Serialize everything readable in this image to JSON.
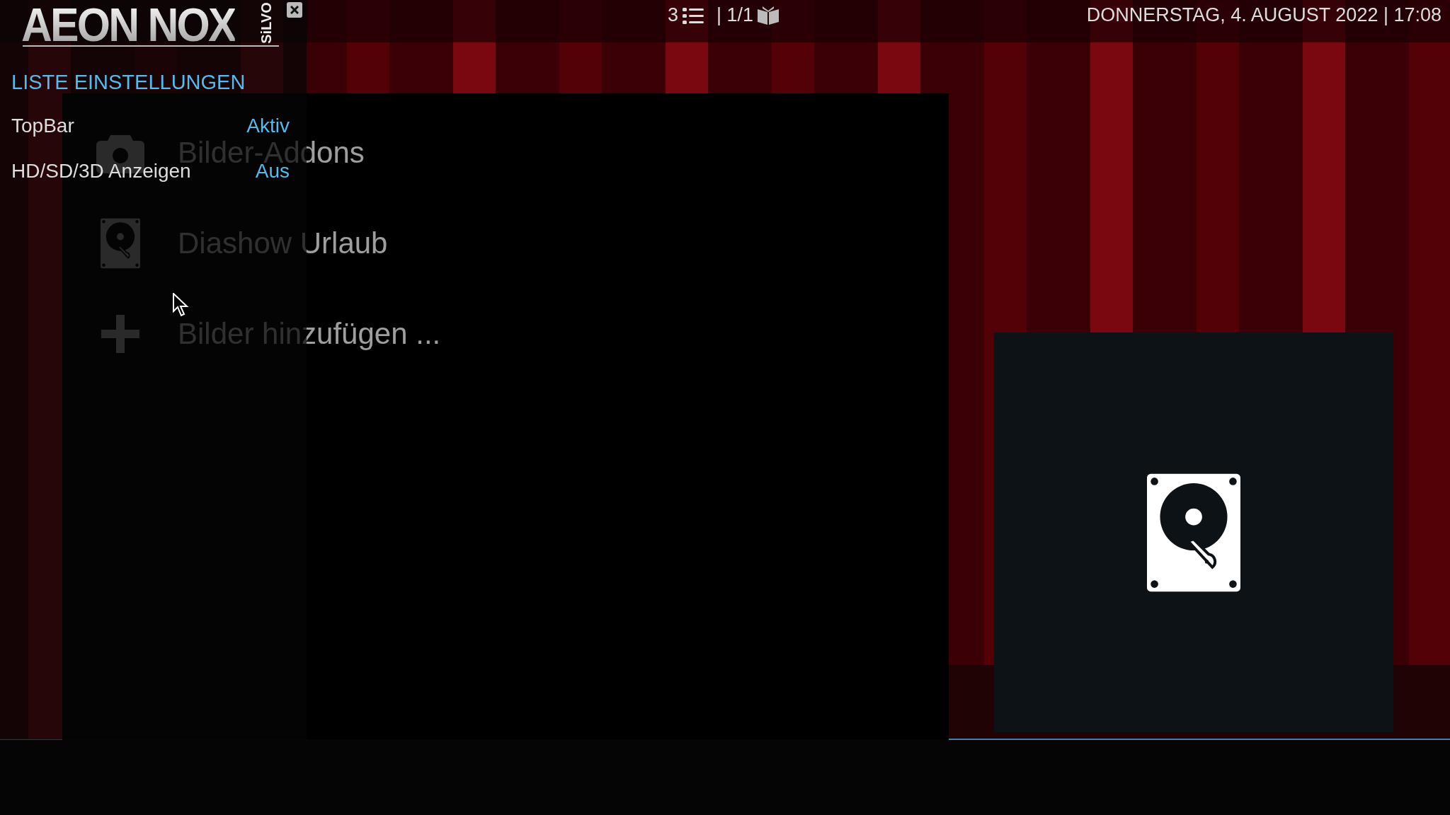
{
  "logo": {
    "title": "AEON NOX",
    "subtitle": "SiLVO"
  },
  "top_bar": {
    "item_count": "3",
    "page": "| 1/1",
    "datetime": "DONNERSTAG, 4. AUGUST 2022 | 17:08"
  },
  "settings_panel": {
    "title": "LISTE EINSTELLUNGEN",
    "options": [
      {
        "label": "TopBar",
        "value": "Aktiv"
      },
      {
        "label": "HD/SD/3D Anzeigen",
        "value": "Aus"
      }
    ]
  },
  "list": {
    "items": [
      {
        "label": "Bilder-Addons",
        "kind": "camera"
      },
      {
        "label": "Diashow Urlaub",
        "kind": "harddisk"
      },
      {
        "label": "Bilder hinzufügen ...",
        "kind": "plus"
      }
    ]
  },
  "preview": {
    "kind": "harddisk"
  }
}
